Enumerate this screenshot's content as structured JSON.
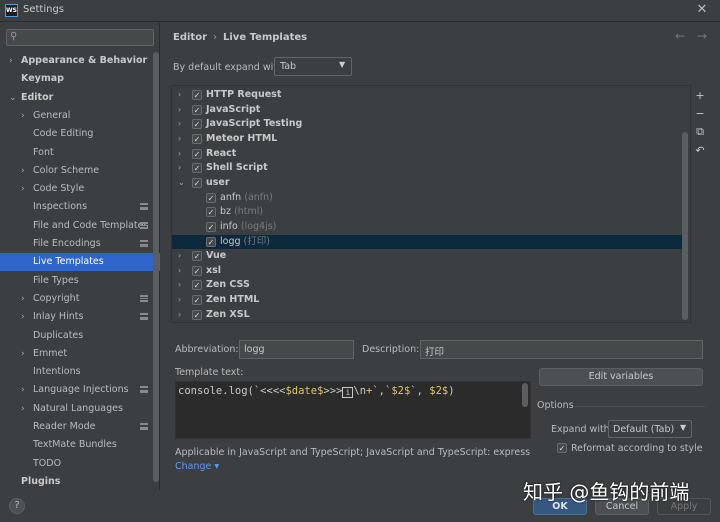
{
  "window": {
    "title": "Settings",
    "logo": "WS"
  },
  "sidebar": {
    "items": [
      {
        "label": "Appearance & Behavior",
        "bold": true,
        "arrow": "›"
      },
      {
        "label": "Keymap",
        "bold": true,
        "arrow": ""
      },
      {
        "label": "Editor",
        "bold": true,
        "arrow": "⌄"
      },
      {
        "label": "General",
        "bold": false,
        "arrow": "›"
      },
      {
        "label": "Code Editing",
        "bold": false,
        "arrow": ""
      },
      {
        "label": "Font",
        "bold": false,
        "arrow": ""
      },
      {
        "label": "Color Scheme",
        "bold": false,
        "arrow": "›"
      },
      {
        "label": "Code Style",
        "bold": false,
        "arrow": "›"
      },
      {
        "label": "Inspections",
        "bold": false,
        "arrow": "",
        "project": true
      },
      {
        "label": "File and Code Templates",
        "bold": false,
        "arrow": "",
        "project": true
      },
      {
        "label": "File Encodings",
        "bold": false,
        "arrow": "",
        "project": true
      },
      {
        "label": "Live Templates",
        "bold": false,
        "arrow": "",
        "selected": true
      },
      {
        "label": "File Types",
        "bold": false,
        "arrow": ""
      },
      {
        "label": "Copyright",
        "bold": false,
        "arrow": "›",
        "project": true
      },
      {
        "label": "Inlay Hints",
        "bold": false,
        "arrow": "›",
        "project": true
      },
      {
        "label": "Duplicates",
        "bold": false,
        "arrow": ""
      },
      {
        "label": "Emmet",
        "bold": false,
        "arrow": "›"
      },
      {
        "label": "Intentions",
        "bold": false,
        "arrow": ""
      },
      {
        "label": "Language Injections",
        "bold": false,
        "arrow": "›",
        "project": true
      },
      {
        "label": "Natural Languages",
        "bold": false,
        "arrow": "›"
      },
      {
        "label": "Reader Mode",
        "bold": false,
        "arrow": "",
        "project": true
      },
      {
        "label": "TextMate Bundles",
        "bold": false,
        "arrow": ""
      },
      {
        "label": "TODO",
        "bold": false,
        "arrow": ""
      },
      {
        "label": "Plugins",
        "bold": true,
        "arrow": ""
      }
    ]
  },
  "header": {
    "breadcrumb_parent": "Editor",
    "breadcrumb_sep": "›",
    "breadcrumb_current": "Live Templates",
    "back_icon": "←",
    "forward_icon": "→"
  },
  "expand": {
    "label": "By default expand with",
    "value": "Tab"
  },
  "templates": [
    {
      "name": "HTTP Request",
      "group": true,
      "expanded": false,
      "checked": true
    },
    {
      "name": "JavaScript",
      "group": true,
      "expanded": false,
      "checked": true
    },
    {
      "name": "JavaScript Testing",
      "group": true,
      "expanded": false,
      "checked": true
    },
    {
      "name": "Meteor HTML",
      "group": true,
      "expanded": false,
      "checked": true
    },
    {
      "name": "React",
      "group": true,
      "expanded": false,
      "checked": true
    },
    {
      "name": "Shell Script",
      "group": true,
      "expanded": false,
      "checked": true
    },
    {
      "name": "user",
      "group": true,
      "expanded": true,
      "checked": true
    },
    {
      "name": "anfn",
      "desc": "(anfn)",
      "group": false,
      "checked": true
    },
    {
      "name": "bz",
      "desc": "(html)",
      "group": false,
      "checked": true
    },
    {
      "name": "info",
      "desc": "(log4js)",
      "group": false,
      "checked": true
    },
    {
      "name": "logg",
      "desc": "(打印)",
      "group": false,
      "checked": true,
      "selected": true
    },
    {
      "name": "Vue",
      "group": true,
      "expanded": false,
      "checked": true
    },
    {
      "name": "xsl",
      "group": true,
      "expanded": false,
      "checked": true
    },
    {
      "name": "Zen CSS",
      "group": true,
      "expanded": false,
      "checked": true
    },
    {
      "name": "Zen HTML",
      "group": true,
      "expanded": false,
      "checked": true
    },
    {
      "name": "Zen XSL",
      "group": true,
      "expanded": false,
      "checked": true
    }
  ],
  "toolbar": {
    "add": "+",
    "remove": "−",
    "copy": "⧉",
    "restore": "↶"
  },
  "form": {
    "abbreviation_label": "Abbreviation:",
    "abbreviation_value": "logg",
    "description_label": "Description:",
    "description_value": "打印",
    "template_text_label": "Template text:",
    "code_a": "console.log(`<<<<",
    "code_var": "$date$",
    "code_b": ">>>",
    "code_box": "i",
    "code_c": "\\n",
    "code_d": "`,`",
    "code_var2": "$2$",
    "code_e": "`, ",
    "code_var3": "$2$",
    "code_f": ")",
    "edit_variables": "Edit variables",
    "applicable": "Applicable in JavaScript and TypeScript; JavaScript and TypeScript: expression, JS...",
    "change": "Change ▾"
  },
  "options": {
    "title": "Options",
    "expand_with_label": "Expand with",
    "expand_with_value": "Default (Tab)",
    "reformat_label": "Reformat according to style",
    "reformat_checked": true
  },
  "buttons": {
    "help": "?",
    "ok": "OK",
    "cancel": "Cancel",
    "apply": "Apply"
  },
  "watermark": "知乎 @鱼钩的前端",
  "colors": {
    "background": "#3c3f41",
    "selection": "#2f65ca",
    "selected_row": "#0d293e",
    "link": "#589df6",
    "variable": "#e0c46c"
  }
}
